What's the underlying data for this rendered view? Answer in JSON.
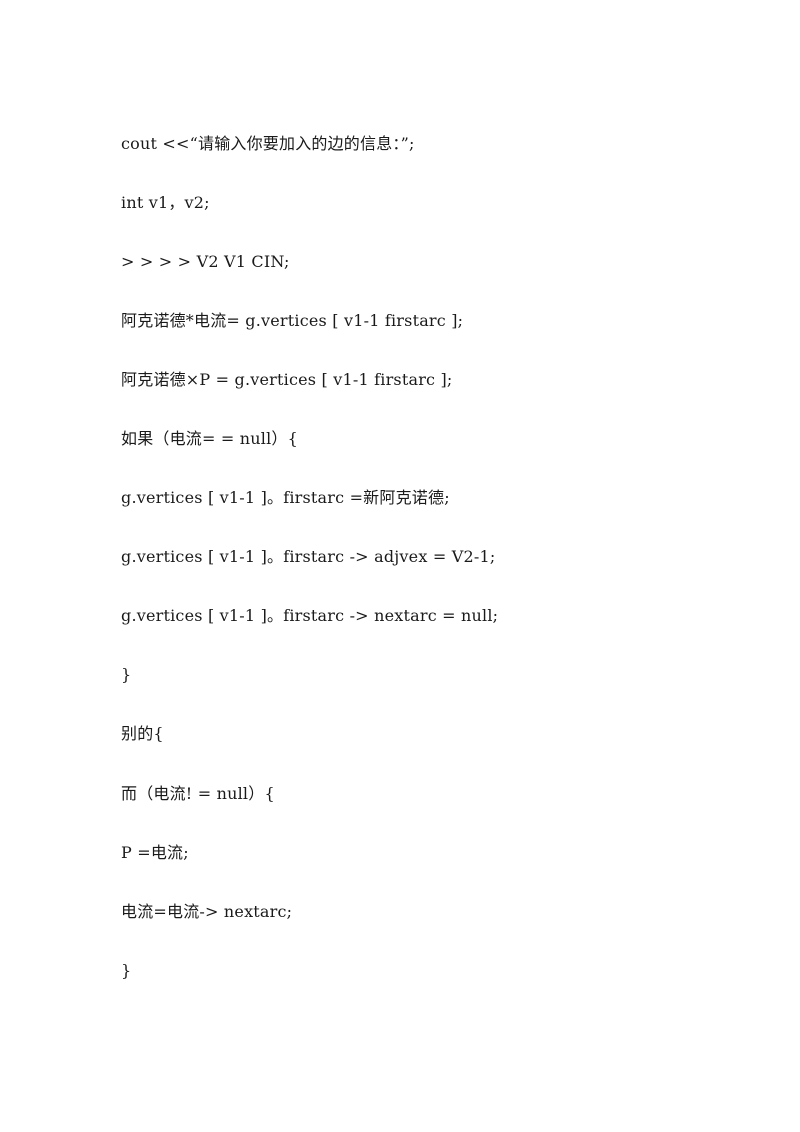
{
  "document": {
    "lines": [
      "cout <<“请输入你要加入的边的信息：”;",
      "int v1，v2;",
      "> > > > V2 V1 CIN;",
      "阿克诺德*电流= g.vertices [ v1-1 firstarc ];",
      "阿克诺德×P = g.vertices [ v1-1 firstarc ];",
      "如果（电流= = null）{",
      "g.vertices [ v1-1 ]。firstarc =新阿克诺德;",
      "g.vertices [ v1-1 ]。firstarc -> adjvex = V2-1;",
      "g.vertices [ v1-1 ]。firstarc -> nextarc = null;",
      "}",
      "别的{",
      "而（电流! = null）{",
      "P =电流;",
      "电流=电流-> nextarc;",
      "}"
    ]
  }
}
